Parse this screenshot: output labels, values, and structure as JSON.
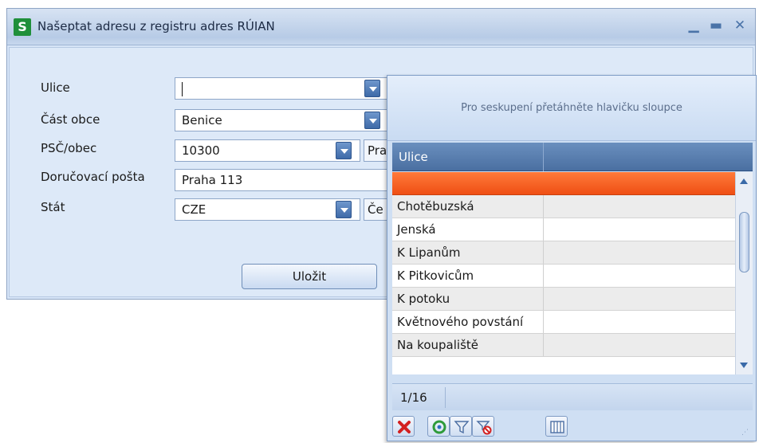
{
  "window": {
    "title": "Našeptat adresu z registru adres RÚIAN",
    "logo_letter": "S"
  },
  "form": {
    "labels": {
      "street": "Ulice",
      "district": "Část obce",
      "zip_city": "PSČ/obec",
      "post_office": "Doručovací pošta",
      "country": "Stát"
    },
    "values": {
      "street": "",
      "district": "Benice",
      "zip": "10300",
      "city_partial": "Pra",
      "post_office": "Praha 113",
      "country_code": "CZE",
      "country_name_partial": "Če"
    },
    "save_label": "Uložit"
  },
  "popup": {
    "group_hint": "Pro seskupení přetáhněte hlavičku sloupce",
    "column_header": "Ulice",
    "rows": [
      {
        "name": "",
        "selected": true
      },
      {
        "name": "Chotěbuzská"
      },
      {
        "name": "Jenská"
      },
      {
        "name": "K Lipanům"
      },
      {
        "name": "K Pitkovicům"
      },
      {
        "name": "K potoku"
      },
      {
        "name": "Květnového povstání"
      },
      {
        "name": "Na koupaliště"
      }
    ],
    "pager": "1/16",
    "toolbar_icons": [
      "clear-icon",
      "refresh-icon",
      "filter-icon",
      "clear-filter-icon",
      "columns-icon"
    ]
  }
}
